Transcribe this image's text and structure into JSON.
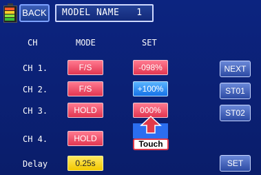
{
  "header": {
    "back_label": "BACK",
    "title": "MODEL NAME   1"
  },
  "columns": {
    "ch": "CH",
    "mode": "MODE",
    "set": "SET"
  },
  "rows": [
    {
      "label": "CH 1.",
      "mode": "F/S",
      "set": "-098%"
    },
    {
      "label": "CH 2.",
      "mode": "F/S",
      "set": "+100%"
    },
    {
      "label": "CH 3.",
      "mode": "HOLD",
      "set": "000%"
    },
    {
      "label": "CH 4.",
      "mode": "HOLD",
      "set": ""
    },
    {
      "label": "Delay",
      "mode": "0.25s"
    }
  ],
  "side_buttons": {
    "next": "NEXT",
    "st01": "ST01",
    "st02": "ST02",
    "set": "SET"
  },
  "annotation": {
    "touch_label": "Touch"
  },
  "battery_icon": "battery-icon",
  "colors": {
    "background": "#0a1e6e",
    "mode_button": "#e23651",
    "mode_button_yellow": "#f2c800",
    "set_button_active": "#1572e8",
    "side_button": "#2c4aa3",
    "touch_highlight": "#e03a4a"
  }
}
